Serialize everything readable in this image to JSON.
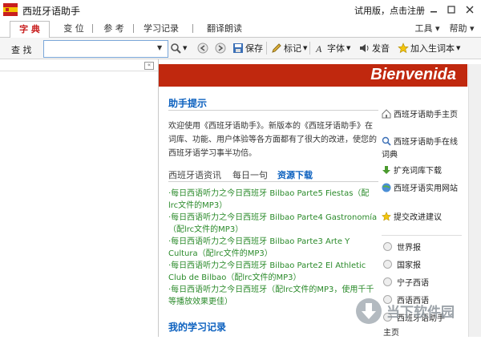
{
  "window": {
    "title": "西班牙语助手",
    "trial_text": "试用版，点击注册",
    "brand_color": "#c0280e"
  },
  "tabs": [
    {
      "label": "字 典"
    },
    {
      "label": "变 位"
    },
    {
      "label": "参 考"
    },
    {
      "label": "学习记录"
    },
    {
      "label": "翻译朗读"
    }
  ],
  "menu": {
    "tools": "工具",
    "help": "帮助"
  },
  "toolbar": {
    "search_label": "查 找",
    "search_value": "",
    "save": "保存",
    "mark": "标记",
    "font": "字体",
    "speak": "发音",
    "add_vocab": "加入生词本"
  },
  "main": {
    "banner": "Bienvenida",
    "tips_title": "助手提示",
    "welcome": "欢迎使用《西班牙语助手》。新版本的《西班牙语助手》在词库、功能、用户体验等各方面都有了很大的改进，使您的西班牙语学习事半功倍。",
    "subtabs": [
      "西班牙语资讯",
      "每日一句",
      "资源下载"
    ],
    "downloads": [
      "·每日西语听力之今日西班牙 Bilbao Parte5 Fiestas（配lrc文件的MP3）",
      "·每日西语听力之今日西班牙 Bilbao Parte4 Gastronomía（配lrc文件的MP3）",
      "·每日西语听力之今日西班牙 Bilbao Parte3 Arte Y Cultura（配lrc文件的MP3）",
      "·每日西语听力之今日西班牙 Bilbao Parte2 El Athletic Club de Bilbao（配lrc文件的MP3）",
      "·每日西语听力之今日西班牙（配lrc文件的MP3，使用千千等播放效果更佳）"
    ],
    "learn_title": "我的学习记录"
  },
  "side": {
    "links": [
      {
        "label": "西班牙语助手主页",
        "icon": "home-icon"
      },
      {
        "label": "西班牙语助手在线词典",
        "icon": "search-icon"
      },
      {
        "label": "扩充词库下载",
        "icon": "download-icon"
      },
      {
        "label": "西班牙语实用网站",
        "icon": "globe-icon"
      },
      {
        "label": "提交改进建议",
        "icon": "star-icon"
      }
    ],
    "papers": [
      "世界报",
      "国家报",
      "宁子西语",
      "西语西语",
      "西班牙语助手"
    ],
    "more": "主页"
  },
  "watermark": "当下软件园"
}
